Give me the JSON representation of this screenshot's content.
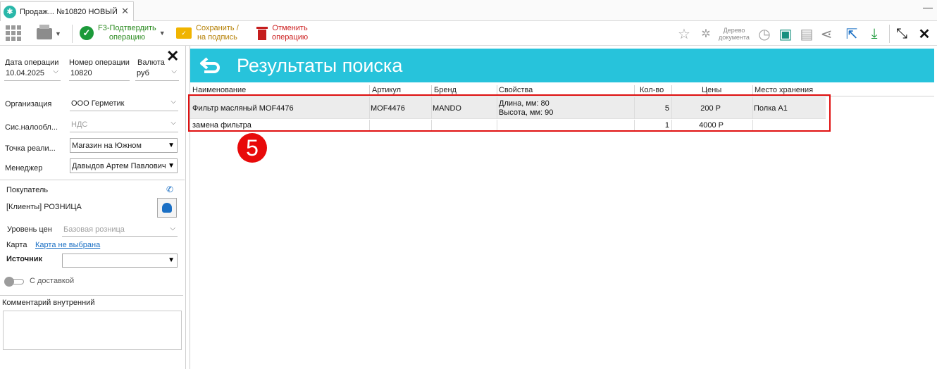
{
  "tab": {
    "title": "Продаж... №10820 НОВЫЙ",
    "close": "✕"
  },
  "window": {
    "minimize": "—"
  },
  "toolbar": {
    "confirm_line1": "F3-Подтвердить",
    "confirm_line2": "операцию",
    "save_line1": "Сохранить /",
    "save_line2": "на подпись",
    "cancel_line1": "Отменить",
    "cancel_line2": "операцию",
    "doc_tree_line1": "Дерево",
    "doc_tree_line2": "документа"
  },
  "form": {
    "date_label": "Дата операции",
    "date_value": "10.04.2025",
    "number_label": "Номер операции",
    "number_value": "10820",
    "currency_label": "Валюта",
    "currency_value": "руб",
    "org_label": "Организация",
    "org_value": "ООО Герметик",
    "tax_label": "Сис.налообл...",
    "tax_value": "НДС",
    "point_label": "Точка реали...",
    "point_value": "Магазин на Южном",
    "manager_label": "Менеджер",
    "manager_value": "Давыдов Артем Павлович",
    "buyer_label": "Покупатель",
    "buyer_value": "[Клиенты] РОЗНИЦА",
    "price_level_label": "Уровень цен",
    "price_level_value": "Базовая розница",
    "card_label": "Карта",
    "card_link": "Карта не выбрана",
    "source_label": "Источник",
    "source_value": "",
    "delivery_label": "С доставкой",
    "comment_label": "Комментарий внутренний"
  },
  "results": {
    "title": "Результаты поиска",
    "columns": [
      "Наименование",
      "Артикул",
      "Бренд",
      "Свойства",
      "Кол-во",
      "Цены",
      "Место хранения"
    ],
    "rows": [
      {
        "name": "Фильтр масляный MOF4476",
        "article": "MOF4476",
        "brand": "MANDO",
        "prop1": "Длина, мм: 80",
        "prop2": "Высота, мм: 90",
        "qty": "5",
        "price": "200 Р",
        "location": "Полка А1"
      },
      {
        "name": "замена фильтра",
        "article": "",
        "brand": "",
        "prop1": "",
        "prop2": "",
        "qty": "1",
        "price": "4000 Р",
        "location": ""
      }
    ]
  },
  "annotation": {
    "step": "5"
  },
  "colors": {
    "banner": "#27c3db",
    "highlight": "#e01010",
    "accent_green": "#1c9a3a"
  }
}
